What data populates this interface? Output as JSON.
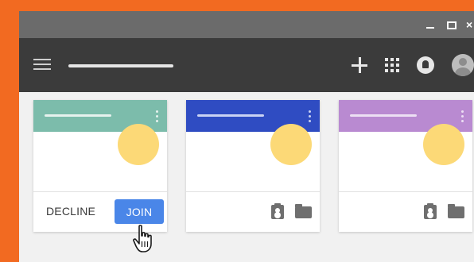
{
  "window": {
    "controls": {
      "minimize_icon": "minimize-icon",
      "maximize_icon": "maximize-icon",
      "close_glyph": "×"
    }
  },
  "appbar": {
    "icons": [
      "menu-icon",
      "add-icon",
      "apps-icon",
      "notification-bell-icon",
      "avatar"
    ]
  },
  "cards": [
    {
      "header_color": "#7cbcab",
      "footer": {
        "decline_label": "DECLINE",
        "join_label": "JOIN"
      }
    },
    {
      "header_color": "#2f4cc2",
      "footer": {
        "icons": [
          "assignment-icon",
          "folder-icon"
        ]
      }
    },
    {
      "header_color": "#b98ad1",
      "footer": {
        "icons": [
          "assignment-icon",
          "folder-icon"
        ]
      }
    }
  ],
  "colors": {
    "background": "#f26a21",
    "titlebar": "#6b6b6b",
    "appbar": "#3b3b3b",
    "content_bg": "#f1f1f1",
    "sun": "#fcd977",
    "join_button": "#4a86e8"
  }
}
